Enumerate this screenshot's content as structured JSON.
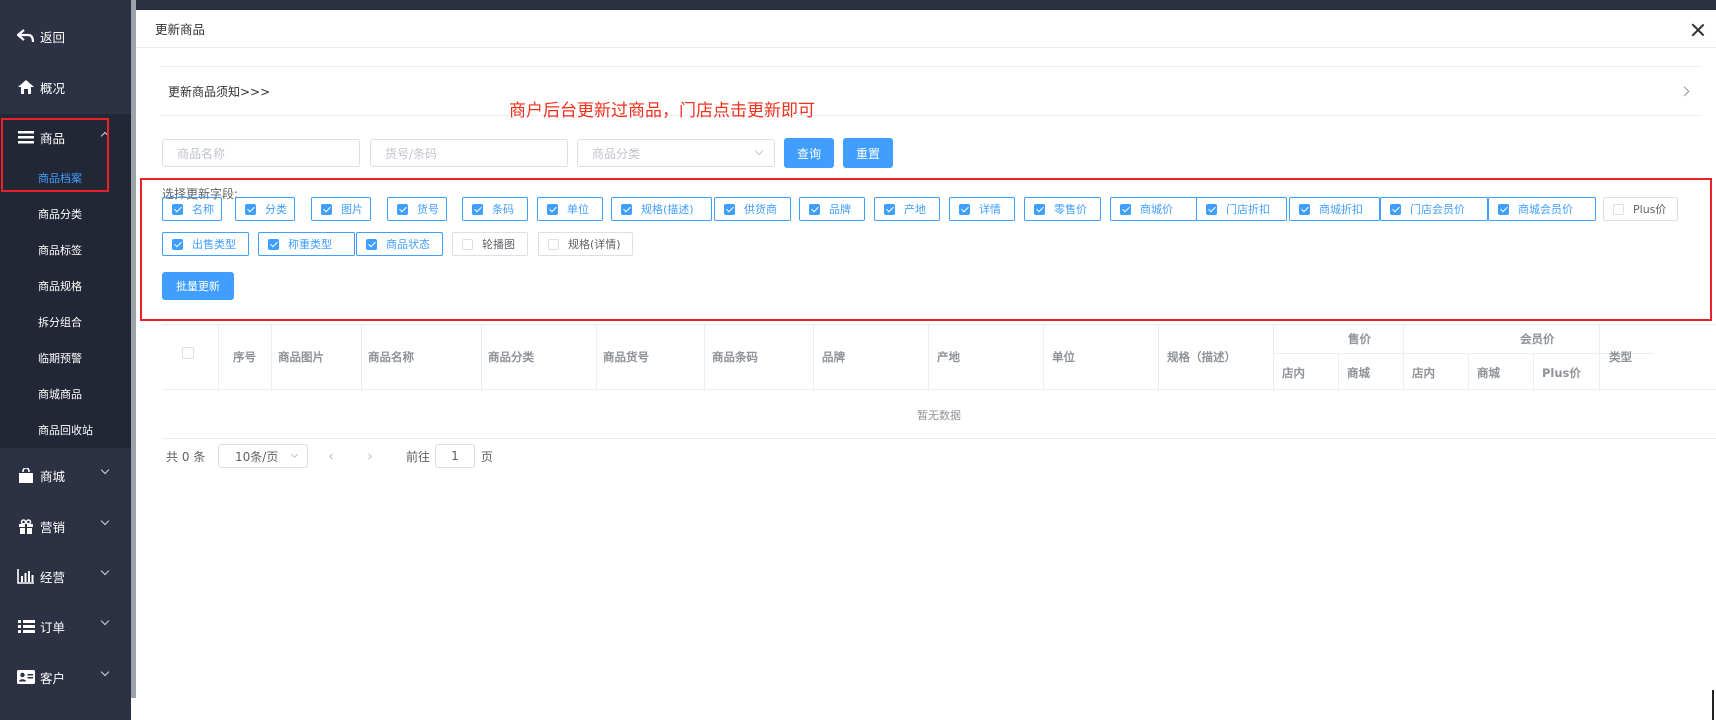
{
  "sidebar": {
    "back": "返回",
    "overview": "概况",
    "goods": "商品",
    "subitems": [
      "商品档案",
      "商品分类",
      "商品标签",
      "商品规格",
      "拆分组合",
      "临期预警",
      "商城商品",
      "商品回收站"
    ],
    "mall": "商城",
    "marketing": "营销",
    "business": "经营",
    "orders": "订单",
    "customers": "客户"
  },
  "modal": {
    "title": "更新商品",
    "notice": "更新商品须知>>>",
    "tip": "商户后台更新过商品，门店点击更新即可"
  },
  "search": {
    "name_placeholder": "商品名称",
    "code_placeholder": "货号/条码",
    "category_placeholder": "商品分类",
    "query": "查询",
    "reset": "重置"
  },
  "fields": {
    "label": "选择更新字段:",
    "items": [
      {
        "label": "名称",
        "checked": true
      },
      {
        "label": "分类",
        "checked": true
      },
      {
        "label": "图片",
        "checked": true
      },
      {
        "label": "货号",
        "checked": true
      },
      {
        "label": "条码",
        "checked": true
      },
      {
        "label": "单位",
        "checked": true
      },
      {
        "label": "规格(描述)",
        "checked": true
      },
      {
        "label": "供货商",
        "checked": true
      },
      {
        "label": "品牌",
        "checked": true
      },
      {
        "label": "产地",
        "checked": true
      },
      {
        "label": "详情",
        "checked": true
      },
      {
        "label": "零售价",
        "checked": true
      },
      {
        "label": "商城价",
        "checked": true
      },
      {
        "label": "门店折扣",
        "checked": true
      },
      {
        "label": "商城折扣",
        "checked": true
      },
      {
        "label": "门店会员价",
        "checked": true
      },
      {
        "label": "商城会员价",
        "checked": true
      },
      {
        "label": "Plus价",
        "checked": false
      },
      {
        "label": "出售类型",
        "checked": true
      },
      {
        "label": "称重类型",
        "checked": true
      },
      {
        "label": "商品状态",
        "checked": true
      },
      {
        "label": "轮播图",
        "checked": false
      },
      {
        "label": "规格(详情)",
        "checked": false
      }
    ],
    "batch_update": "批量更新"
  },
  "table": {
    "headers": [
      "序号",
      "商品图片",
      "商品名称",
      "商品分类",
      "商品货号",
      "商品条码",
      "品牌",
      "产地",
      "单位",
      "规格（描述）"
    ],
    "price_group": "售价",
    "member_group": "会员价",
    "price_sub": [
      "店内",
      "商城"
    ],
    "member_sub": [
      "店内",
      "商城",
      "Plus价"
    ],
    "type": "类型",
    "empty": "暂无数据"
  },
  "pagination": {
    "total": "共 0 条",
    "page_size": "10条/页",
    "goto": "前往",
    "page": "1",
    "page_unit": "页"
  },
  "colors": {
    "primary": "#409eff",
    "sidebar": "#2c3244",
    "highlight_red": "#e8212a"
  }
}
